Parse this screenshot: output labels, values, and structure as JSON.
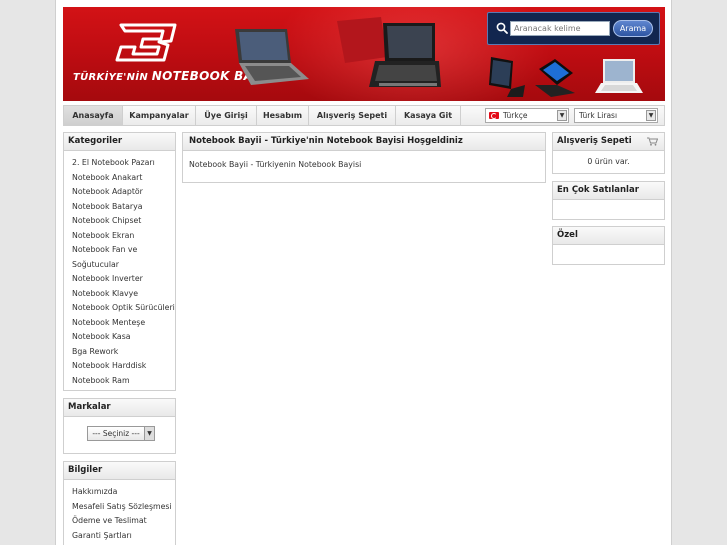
{
  "header": {
    "tagline_prefix": "TÜRKİYE'NİN ",
    "tagline_brand": "NOTEBOOK BAYİİ",
    "search": {
      "placeholder": "Aranacak kelime",
      "button_label": "Arama"
    }
  },
  "nav": {
    "tabs": [
      {
        "label": "Anasayfa"
      },
      {
        "label": "Kampanyalar"
      },
      {
        "label": "Üye Girişi"
      },
      {
        "label": "Hesabım"
      },
      {
        "label": "Alışveriş Sepeti"
      },
      {
        "label": "Kasaya Git"
      }
    ],
    "language": "Türkçe",
    "currency": "Türk Lirası"
  },
  "sidebar_left": {
    "categories_title": "Kategoriler",
    "categories": [
      "2. El Notebook Pazarı",
      "Notebook Anakart",
      "Notebook Adaptör",
      "Notebook Batarya",
      "Notebook Chipset",
      "Notebook Ekran",
      "Notebook Fan ve",
      "Soğutucular",
      "Notebook Inverter",
      "Notebook Klavye",
      "Notebook Optik Sürücüleri",
      "Notebook Menteşe",
      "Notebook Kasa",
      "Bga Rework",
      "Notebook Harddisk",
      "Notebook Ram"
    ],
    "brands_title": "Markalar",
    "brands_select": "--- Seçiniz ---",
    "info_title": "Bilgiler",
    "info_links": [
      "Hakkımızda",
      "Mesafeli Satış Sözleşmesi",
      "Ödeme ve Teslimat",
      "Garanti Şartları"
    ]
  },
  "main": {
    "title": "Notebook Bayii - Türkiye'nin Notebook Bayisi Hoşgeldiniz",
    "body": "Notebook Bayii - Türkiyenin Notebook Bayisi"
  },
  "sidebar_right": {
    "cart_title": "Alışveriş Sepeti",
    "cart_status": "0 ürün var.",
    "bestsellers_title": "En Çok Satılanlar",
    "special_title": "Özel"
  },
  "colors": {
    "banner_red": "#c00d12",
    "search_bg": "#12264f",
    "search_button": "#2e55a2"
  }
}
